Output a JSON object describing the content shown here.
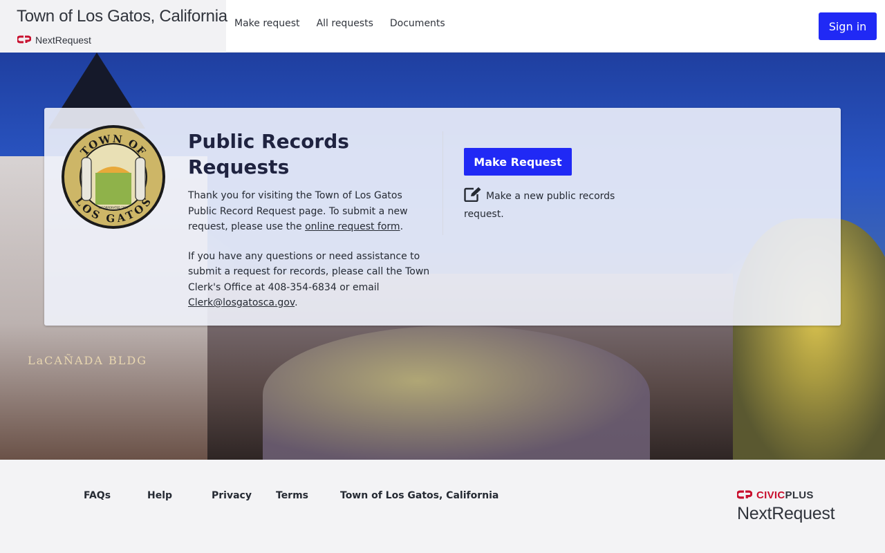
{
  "header": {
    "title": "Town of Los Gatos, California",
    "logo_text": "NextRequest",
    "nav": [
      "Make request",
      "All requests",
      "Documents"
    ],
    "sign_in": "Sign in"
  },
  "hero": {
    "building_sign": "LaCAÑADA BLDG"
  },
  "card": {
    "seal": {
      "top_text": "TOWN OF",
      "bottom_text": "LOS GATOS",
      "small_text": "INCORPORATED 1887"
    },
    "title": "Public Records Requests",
    "para1_prefix": "Thank you for visiting the Town of Los Gatos Public Record Request page. To submit a new request, please use the ",
    "para1_link": "online request form",
    "para1_suffix": ".",
    "para2_prefix": "If you have any questions or need assistance to submit a request for records, please call the Town Clerk's Office at 408-354-6834 or email ",
    "para2_link": "Clerk@losgatosca.gov",
    "para2_suffix": ".",
    "make_request_button": "Make Request",
    "make_request_desc": "Make a new public records request."
  },
  "footer": {
    "links": [
      "FAQs",
      "Help",
      "Privacy",
      "Terms",
      "Town of Los Gatos, California"
    ],
    "civic_brand": "CIVIC",
    "civic_brand_plus": "PLUS",
    "nextrequest": "NextRequest"
  },
  "colors": {
    "primary_button": "#2029f5",
    "brand_red": "#c8102e",
    "footer_bg": "#f3f3f5",
    "header_brand_bg": "#f2f2f4"
  },
  "icons": [
    "civicplus-logo-icon",
    "edit-icon",
    "town-seal-icon"
  ]
}
